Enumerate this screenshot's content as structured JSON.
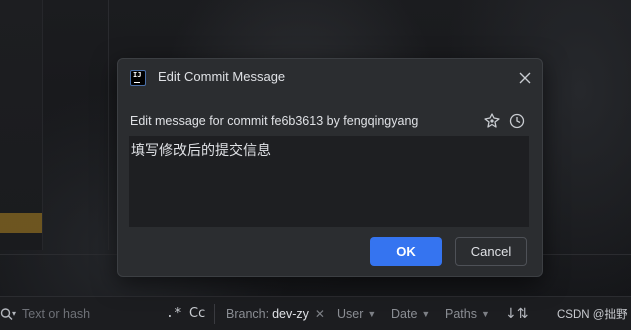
{
  "dialog": {
    "title": "Edit Commit Message",
    "app_icon_text": "IJ",
    "prompt": "Edit message for commit fe6b3613 by fengqingyang",
    "message": "填写修改后的提交信息",
    "ok_label": "OK",
    "cancel_label": "Cancel",
    "icons": {
      "close": "close-icon",
      "ai": "ai-assistant-icon",
      "history": "clock-history-icon"
    },
    "accent_color": "#3574f0"
  },
  "toolbar": {
    "search_placeholder": "Text or hash",
    "search_icon_glyph": "Q",
    "search_chevron": "▾",
    "regex_label": ".*",
    "case_label": "Cc",
    "branch_label": "Branch:",
    "branch_value": "dev-zy",
    "branch_clear": "✕",
    "user_label": "User",
    "date_label": "Date",
    "paths_label": "Paths",
    "sort_glyph": "↓⇅"
  },
  "watermark": "CSDN @拙野"
}
